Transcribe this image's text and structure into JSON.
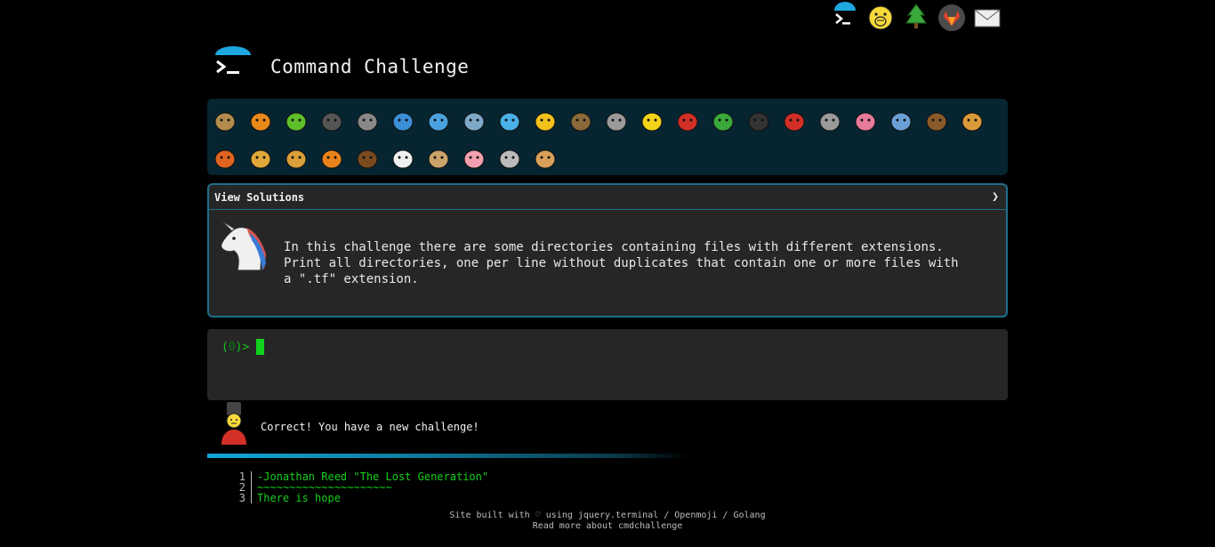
{
  "app": {
    "title": "Command Challenge"
  },
  "top_icons": [
    "terminal-icon",
    "face-hand-over-mouth-icon",
    "tree-icon",
    "gitlab-fox-icon",
    "envelope-icon"
  ],
  "animals_row1": [
    "snail-icon",
    "butterfly-icon",
    "caterpillar-icon",
    "ant-icon",
    "spider-web-icon",
    "whale-icon",
    "shark-icon",
    "dolphin-icon",
    "fish-icon",
    "tropical-fish-icon",
    "blowfish-icon",
    "wolf-icon",
    "bee-icon",
    "ladybug-icon",
    "cricket-icon",
    "spider-icon",
    "scorpion-icon",
    "fly-icon",
    "worm-icon",
    "microbe-icon",
    "monkey-icon",
    "dog-icon"
  ],
  "animals_row2": [
    "fox-icon",
    "cat-icon",
    "lion-icon",
    "tiger-icon",
    "horse-icon",
    "unicorn-icon",
    "cow-icon",
    "pig-icon",
    "mouse-icon",
    "hamster-icon"
  ],
  "solutions": {
    "header": "View Solutions",
    "chevron": "❯",
    "description": "In this challenge there are some directories containing files with different extensions.\nPrint all directories, one per line without duplicates that contain one or more files with\na \".tf\" extension."
  },
  "terminal": {
    "prompt_open": "(",
    "exit_code": "0",
    "prompt_close": ")>"
  },
  "message": "Correct! You have a new challenge!",
  "poem": [
    {
      "n": "1",
      "t": "-Jonathan Reed \"The Lost Generation\""
    },
    {
      "n": "2",
      "t": "~~~~~~~~~~~~~~~~~~~~~"
    },
    {
      "n": "3",
      "t": "There is hope"
    }
  ],
  "footer": {
    "line1": "Site built with ♡ using jquery.terminal / Openmoji / Golang",
    "line2": "Read more about cmdchallenge"
  },
  "colors": {
    "accent": "#1e6f8c",
    "terminal_green": "#12c81a",
    "strip_bg": "#062530",
    "panel_bg": "#262626"
  }
}
